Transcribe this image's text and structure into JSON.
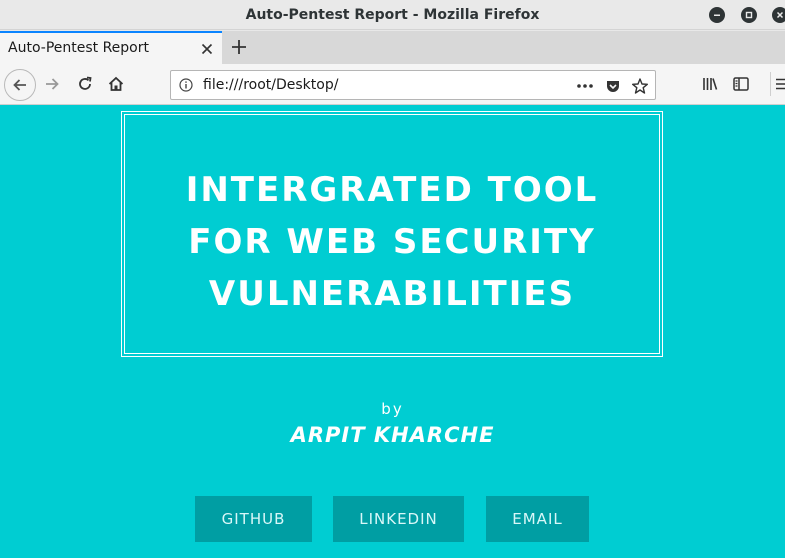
{
  "window": {
    "title": "Auto-Pentest Report - Mozilla Firefox"
  },
  "tab": {
    "title": "Auto-Pentest Report"
  },
  "navbar": {
    "url": "file:///root/Desktop/"
  },
  "page": {
    "title_lines": [
      "INTERGRATED TOOL",
      "FOR WEB SECURITY",
      "VULNERABILITIES"
    ],
    "by": "by",
    "author": "ARPIT KHARCHE",
    "buttons": {
      "github": "GITHUB",
      "linkedin": "LINKEDIN",
      "email": "EMAIL"
    }
  },
  "colors": {
    "page_background": "#00cdd2",
    "button_background": "#009ea3",
    "tab_accent": "#0a84ff"
  },
  "icons": {
    "titlebar": [
      "minimize-icon",
      "maximize-icon",
      "close-icon"
    ],
    "navbar": [
      "back-icon",
      "forward-icon",
      "reload-icon",
      "home-icon",
      "info-icon",
      "page-actions-icon",
      "pocket-icon",
      "bookmark-star-icon",
      "library-icon",
      "sidebar-icon",
      "menu-icon"
    ]
  }
}
